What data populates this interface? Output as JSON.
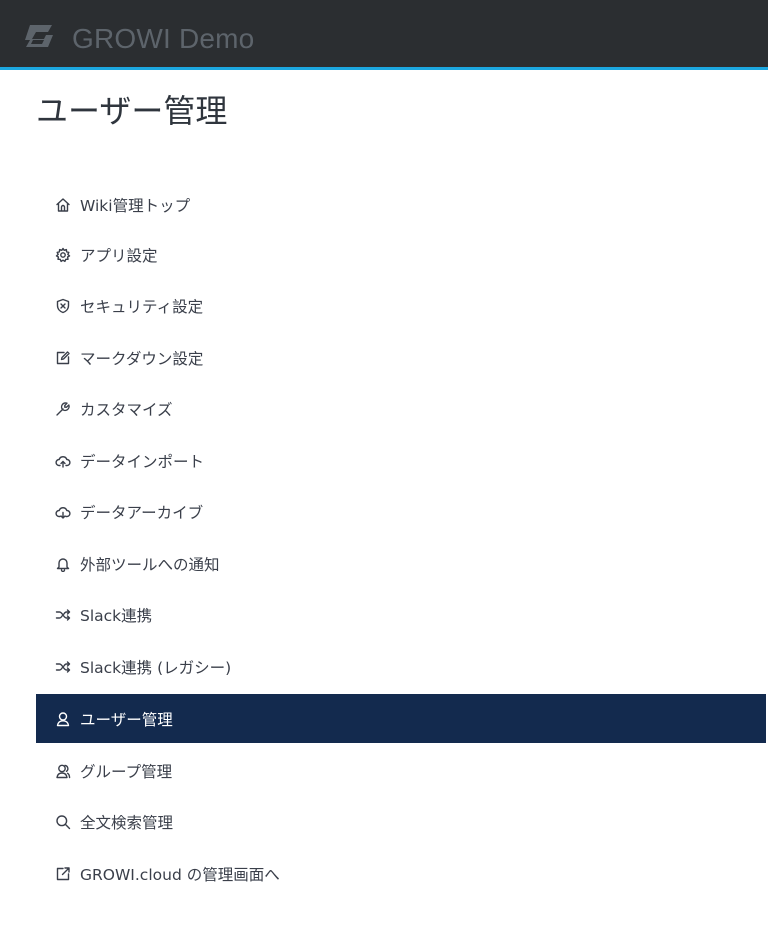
{
  "app": {
    "brand_name": "GROWI Demo",
    "logo_icon": "growi-logo-icon",
    "navbar_color": "#2b2e31",
    "accent_color": "#1ca7e0"
  },
  "page": {
    "title": "ユーザー管理"
  },
  "menu": {
    "active_color": "#132a4e",
    "items": [
      {
        "label": "Wiki管理トップ",
        "icon": "home-icon"
      },
      {
        "label": "アプリ設定",
        "icon": "gear-icon"
      },
      {
        "label": "セキュリティ設定",
        "icon": "shield-icon"
      },
      {
        "label": "マークダウン設定",
        "icon": "edit-icon"
      },
      {
        "label": "カスタマイズ",
        "icon": "wrench-icon"
      },
      {
        "label": "データインポート",
        "icon": "cloud-upload-icon"
      },
      {
        "label": "データアーカイブ",
        "icon": "cloud-download-icon"
      },
      {
        "label": "外部ツールへの通知",
        "icon": "bell-icon"
      },
      {
        "label": "Slack連携",
        "icon": "shuffle-icon"
      },
      {
        "label": "Slack連携 (レガシー)",
        "icon": "shuffle-icon"
      },
      {
        "label": "ユーザー管理",
        "icon": "user-icon",
        "active": true
      },
      {
        "label": "グループ管理",
        "icon": "users-icon"
      },
      {
        "label": "全文検索管理",
        "icon": "search-icon"
      },
      {
        "label": "GROWI.cloud の管理画面へ",
        "icon": "external-link-icon"
      }
    ]
  }
}
